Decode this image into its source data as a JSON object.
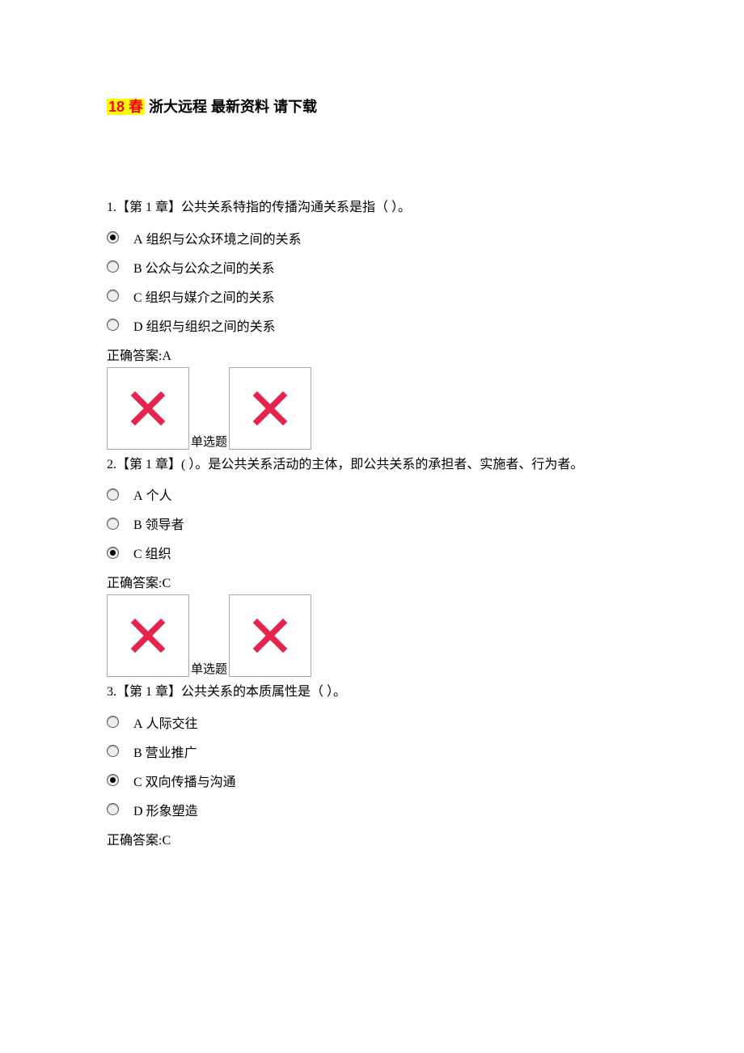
{
  "title": {
    "highlight": "18 春",
    "rest": "   浙大远程     最新资料  请下载"
  },
  "questions": [
    {
      "num": "1.",
      "stem": "【第 1 章】公共关系特指的传播沟通关系是指（ ）。",
      "options": [
        {
          "letter": "A",
          "text": "  组织与公众环境之间的关系",
          "selected": true
        },
        {
          "letter": "B",
          "text": "  公众与公众之间的关系",
          "selected": false
        },
        {
          "letter": "C",
          "text": "  组织与媒介之间的关系",
          "selected": false
        },
        {
          "letter": "D",
          "text": "  组织与组织之间的关系",
          "selected": false
        }
      ],
      "answer": "正确答案:A",
      "placeholder_label": "单选题",
      "show_placeholder": true
    },
    {
      "num": "2.",
      "stem": "【第 1 章】( ）。是公共关系活动的主体，即公共关系的承担者、实施者、行为者。",
      "options": [
        {
          "letter": "A",
          "text": "  个人",
          "selected": false
        },
        {
          "letter": "B",
          "text": "  领导者",
          "selected": false
        },
        {
          "letter": "C",
          "text": "  组织",
          "selected": true
        }
      ],
      "answer": "正确答案:C",
      "placeholder_label": "单选题",
      "show_placeholder": true
    },
    {
      "num": "3.",
      "stem": "【第 1 章】公共关系的本质属性是（ ）。",
      "options": [
        {
          "letter": "A",
          "text": "  人际交往",
          "selected": false
        },
        {
          "letter": "B",
          "text": "  营业推广",
          "selected": false
        },
        {
          "letter": "C",
          "text": "  双向传播与沟通",
          "selected": true
        },
        {
          "letter": "D",
          "text": "  形象塑造",
          "selected": false
        }
      ],
      "answer": "正确答案:C",
      "placeholder_label": "",
      "show_placeholder": false
    }
  ]
}
